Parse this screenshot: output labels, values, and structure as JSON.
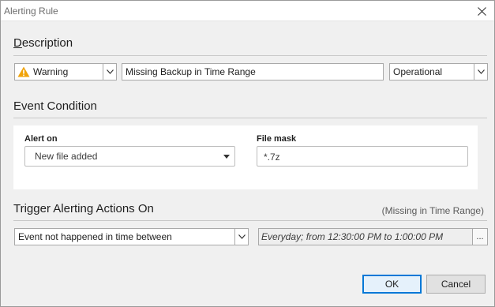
{
  "window": {
    "title": "Alerting Rule"
  },
  "description": {
    "heading_first_letter": "D",
    "heading_rest": "escription",
    "severity": {
      "label": "Warning",
      "icon": "warning-triangle-icon",
      "icon_color": "#f0a30a"
    },
    "name_value": "Missing Backup in Time Range",
    "category": "Operational"
  },
  "event_condition": {
    "heading": "Event Condition",
    "alert_on_label": "Alert on",
    "alert_on_value": "New file added",
    "file_mask_label": "File mask",
    "file_mask_value": "*.7z"
  },
  "trigger": {
    "heading": "Trigger Alerting Actions On",
    "hint": "(Missing in Time Range)",
    "condition_value": "Event not happened  in time between",
    "schedule_value": "Everyday; from 12:30:00 PM to 1:00:00 PM",
    "schedule_button": "..."
  },
  "buttons": {
    "ok": "OK",
    "cancel": "Cancel"
  },
  "colors": {
    "accent": "#0078d7",
    "panel_bg": "#ffffff",
    "dialog_bg": "#f0f0f0"
  }
}
